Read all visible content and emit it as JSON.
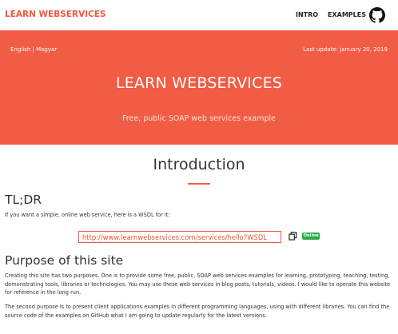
{
  "nav": {
    "brand": "LEARN WEBSERVICES",
    "intro": "INTRO",
    "examples": "EXAMPLES",
    "github_icon": "github-icon"
  },
  "hero": {
    "language": "English | Magyar",
    "last_update": "Last update: january 20, 2019",
    "title": "LEARN WEBSERVICES",
    "subtitle": "Free, public SOAP web services example"
  },
  "intro": {
    "title": "Introduction"
  },
  "tldr": {
    "heading": "TL;DR",
    "text": "If you want a simple, online web service, here is a WSDL for it:",
    "wsdl_url": "http://www.learnwebservices.com/services/hello?WSDL",
    "copy_icon": "copy-icon",
    "status_badge": "Online"
  },
  "purpose": {
    "heading": "Purpose of this site",
    "p1": "Creating this site has two purposes. One is to provide some free, public, SOAP web services examples for learning, prototyping, teaching, testing, demonstrating tools, libraries or technologies. You may use these web services in blog posts, tutorials, videos. I would like to operate this website for reference in the long run.",
    "p2": "The second purpose is to present client applications examples in different programming languages, using with different libraries. You can find the source code of the examples on GitHub what I am going to update regularly for the latest versions."
  },
  "colors": {
    "accent": "#f15c44",
    "badge": "#2ea94a"
  }
}
